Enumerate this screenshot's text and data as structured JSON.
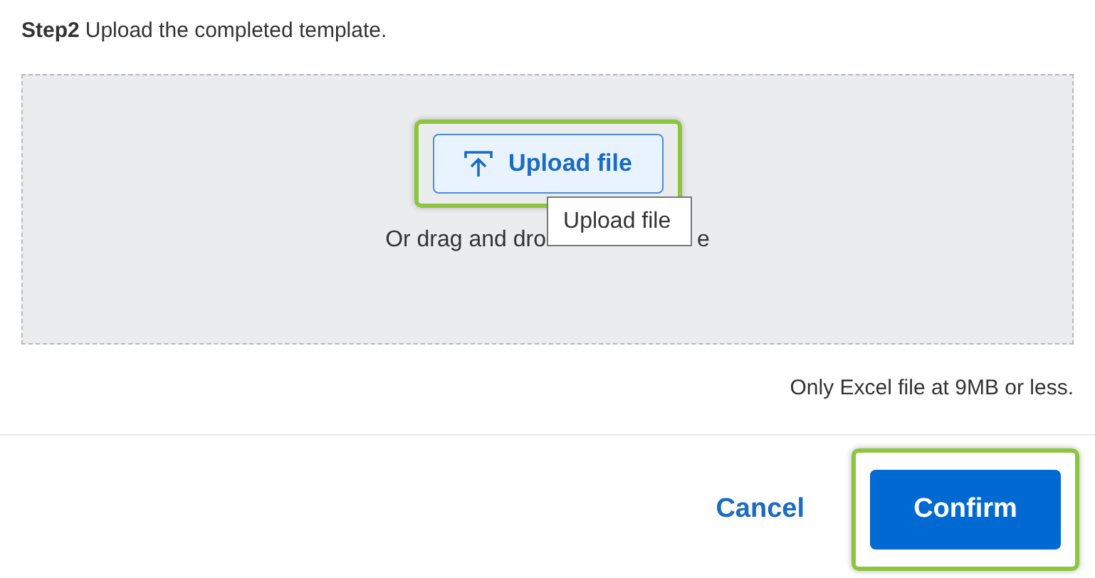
{
  "step": {
    "label": "Step2",
    "text": "Upload the completed template."
  },
  "dropzone": {
    "upload_button": "Upload file",
    "hint_before": "Or drag and dro",
    "hint_after": "e",
    "tooltip": "Upload file"
  },
  "size_note": "Only Excel file at 9MB or less.",
  "buttons": [
    {
      "kind": "link",
      "label": "Cancel"
    },
    {
      "kind": "primary",
      "label": "Confirm"
    }
  ]
}
